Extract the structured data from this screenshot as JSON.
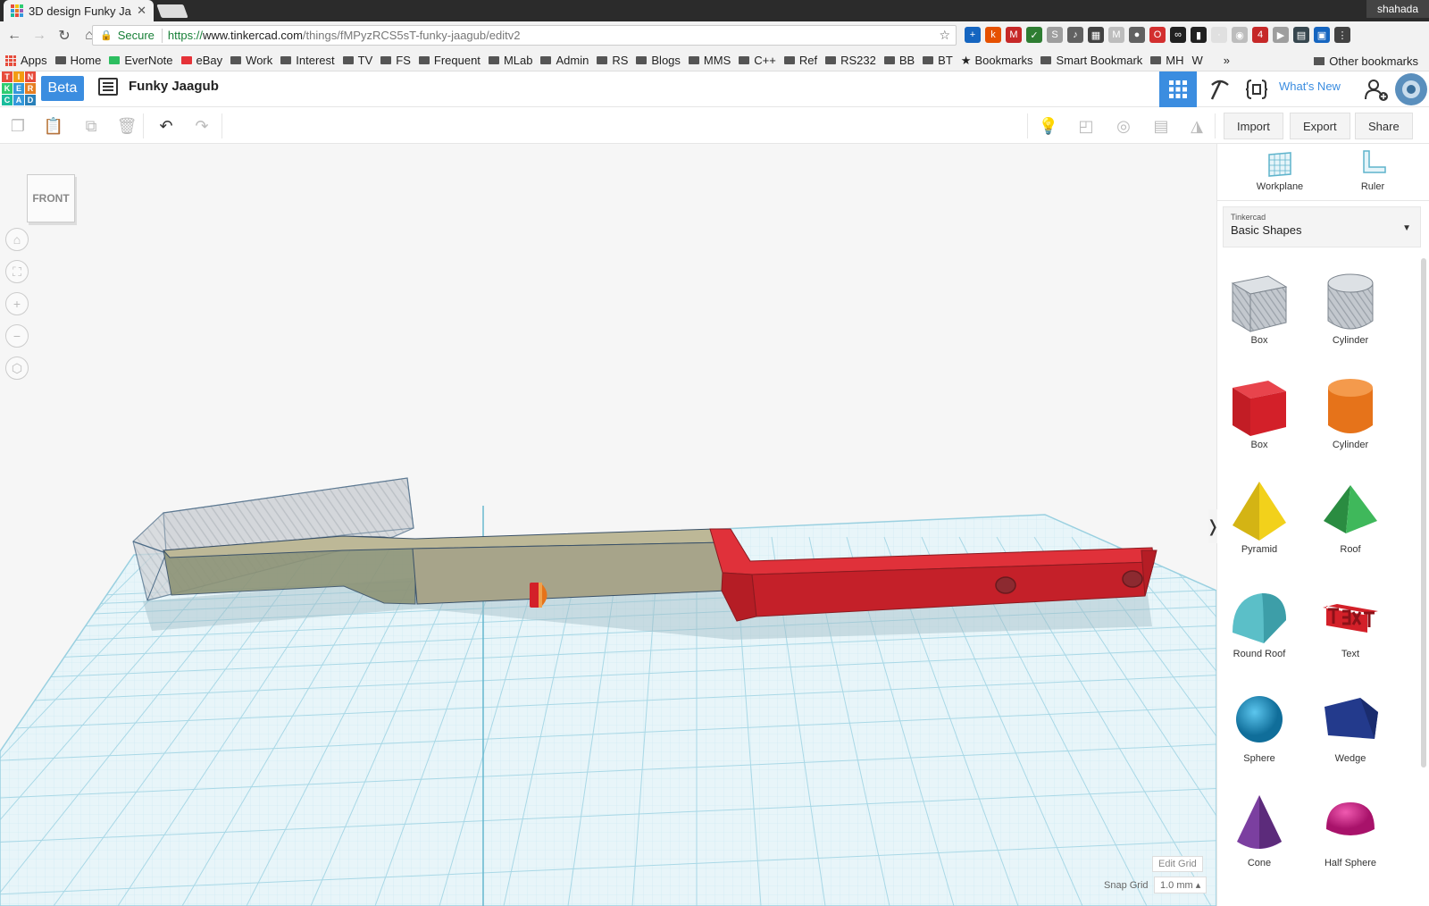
{
  "browser": {
    "tab_title": "3D design Funky Ja",
    "profile": "shahada",
    "secure_label": "Secure",
    "url_https": "https://",
    "url_host": "www.tinkercad.com",
    "url_path": "/things/fMPyzRCS5sT-funky-jaagub/editv2",
    "bookmarks": [
      "Apps",
      "Home",
      "EverNote",
      "eBay",
      "Work",
      "Interest",
      "TV",
      "FS",
      "Frequent",
      "MLab",
      "Admin",
      "RS",
      "Blogs",
      "MMS",
      "C++",
      "Ref",
      "RS232",
      "BB",
      "BT",
      "Bookmarks",
      "Smart Bookmark",
      "MH",
      "W"
    ],
    "other_bookmarks": "Other bookmarks",
    "overflow": "»"
  },
  "header": {
    "logo_letters": [
      "T",
      "I",
      "N",
      "K",
      "E",
      "R",
      "C",
      "A",
      "D"
    ],
    "beta": "Beta",
    "design_name": "Funky Jaagub",
    "whats_new": "What's New"
  },
  "toolbar": {
    "import": "Import",
    "export": "Export",
    "share": "Share"
  },
  "viewport": {
    "view_cube_face": "FRONT",
    "edit_grid": "Edit Grid",
    "snap_grid_label": "Snap Grid",
    "snap_grid_value": "1.0 mm ▴",
    "collapse_icon": "❭"
  },
  "panel": {
    "tools": [
      "Workplane",
      "Ruler"
    ],
    "library_source": "Tinkercad",
    "library_name": "Basic Shapes",
    "shapes": [
      {
        "label": "Box",
        "kind": "box-hole",
        "color": "#a8aeb6"
      },
      {
        "label": "Cylinder",
        "kind": "cylinder-hole",
        "color": "#a8aeb6"
      },
      {
        "label": "Box",
        "kind": "box",
        "color": "#d32029"
      },
      {
        "label": "Cylinder",
        "kind": "cylinder",
        "color": "#e6731a"
      },
      {
        "label": "Pyramid",
        "kind": "pyramid",
        "color": "#f2d11b"
      },
      {
        "label": "Roof",
        "kind": "roof",
        "color": "#2fa04a"
      },
      {
        "label": "Round Roof",
        "kind": "round-roof",
        "color": "#5bbfc8"
      },
      {
        "label": "Text",
        "kind": "text",
        "color": "#d32029"
      },
      {
        "label": "Sphere",
        "kind": "sphere",
        "color": "#1a95c9"
      },
      {
        "label": "Wedge",
        "kind": "wedge",
        "color": "#233a8c"
      },
      {
        "label": "Cone",
        "kind": "cone",
        "color": "#7b3fa0"
      },
      {
        "label": "Half Sphere",
        "kind": "half-sphere",
        "color": "#d6198a"
      }
    ]
  },
  "colors": {
    "accent": "#3b8de0",
    "grid": "#bfe4ee",
    "red_part": "#d32029",
    "olive_part": "#a7a48a"
  }
}
